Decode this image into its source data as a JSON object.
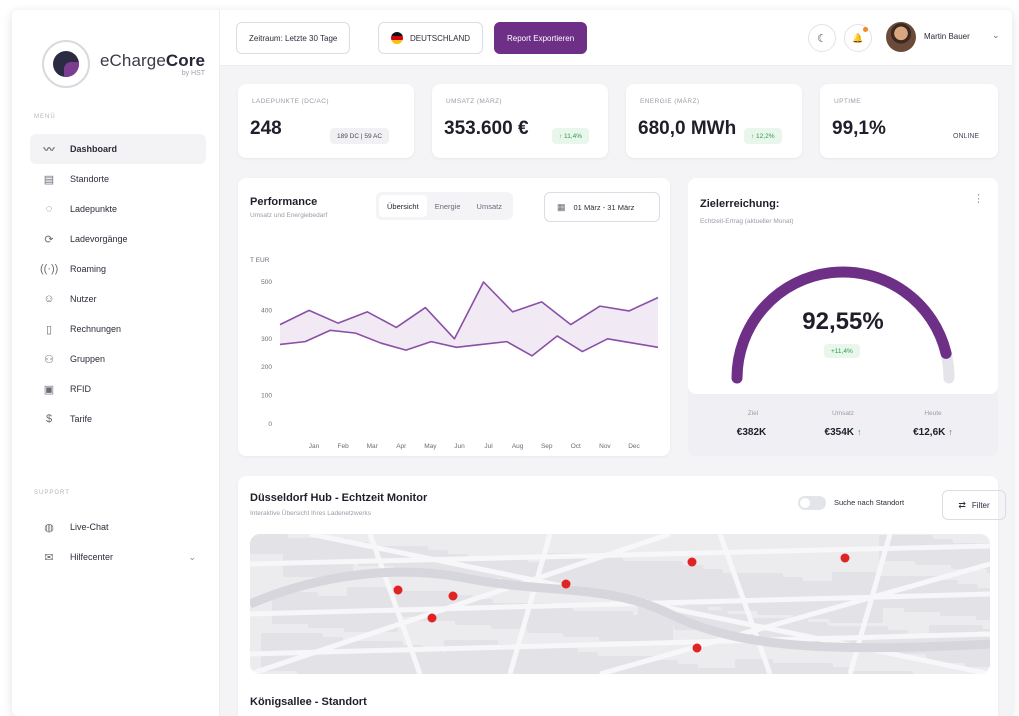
{
  "app": {
    "name_light": "eCharge",
    "name_bold": "Core",
    "sub": "by HST"
  },
  "sidebar": {
    "menu_label": "MENÜ",
    "items": [
      {
        "label": "Dashboard",
        "icon": "trend-icon",
        "glyph": "〰"
      },
      {
        "label": "Standorte",
        "icon": "building-icon",
        "glyph": "▤"
      },
      {
        "label": "Ladepunkte",
        "icon": "charger-icon",
        "glyph": "◌"
      },
      {
        "label": "Ladevorgänge",
        "icon": "refresh-icon",
        "glyph": "⟳"
      },
      {
        "label": "Roaming",
        "icon": "signal-icon",
        "glyph": "((·))"
      },
      {
        "label": "Nutzer",
        "icon": "user-icon",
        "glyph": "☺"
      },
      {
        "label": "Rechnungen",
        "icon": "invoice-icon",
        "glyph": "▯"
      },
      {
        "label": "Gruppen",
        "icon": "group-icon",
        "glyph": "⚇"
      },
      {
        "label": "RFID",
        "icon": "rfid-icon",
        "glyph": "▣"
      },
      {
        "label": "Tarife",
        "icon": "dollar-icon",
        "glyph": "$"
      }
    ],
    "support_label": "SUPPORT",
    "support_items": [
      {
        "label": "Live-Chat",
        "icon": "chat-icon",
        "glyph": "◍"
      },
      {
        "label": "Hilfecenter",
        "icon": "mail-icon",
        "glyph": "✉"
      }
    ]
  },
  "topbar": {
    "period": "Zeitraum: Letzte 30 Tage",
    "country": "DEUTSCHLAND",
    "export": "Report Exportieren",
    "theme_glyph": "☾",
    "bell_glyph": "🔔",
    "user": "Martin Bauer",
    "chev": "⌄"
  },
  "kpis": [
    {
      "label": "LADEPUNKTE (DC/AC)",
      "value": "248",
      "badge": "189 DC | 59 AC"
    },
    {
      "label": "UMSATZ (MÄRZ)",
      "value": "353.600 €",
      "badge": "↑ 11,4%"
    },
    {
      "label": "ENERGIE (MÄRZ)",
      "value": "680,0 MWh",
      "badge": "↑ 12,2%"
    },
    {
      "label": "UPTIME",
      "value": "99,1%",
      "badge": "ONLINE"
    }
  ],
  "performance": {
    "title": "Performance",
    "subtitle": "Umsatz und Energiebedarf",
    "tabs": [
      "Übersicht",
      "Energie",
      "Umsatz"
    ],
    "date_range": "01 März - 31 März",
    "calendar_glyph": "▦",
    "chart_data": {
      "type": "line",
      "ylabel": "T EUR",
      "ylim": [
        0,
        500
      ],
      "yticks": [
        0,
        100,
        200,
        300,
        400,
        500
      ],
      "categories": [
        "Jan",
        "Feb",
        "Mar",
        "Apr",
        "May",
        "Jun",
        "Jul",
        "Aug",
        "Sep",
        "Oct",
        "Nov",
        "Dec"
      ],
      "series": [
        {
          "values": [
            350,
            400,
            355,
            395,
            340,
            410,
            300,
            500,
            395,
            430,
            350,
            415,
            398,
            445
          ],
          "color": "#8a4fa6"
        },
        {
          "values": [
            280,
            290,
            330,
            320,
            285,
            260,
            290,
            270,
            280,
            290,
            240,
            310,
            255,
            300,
            285,
            270
          ],
          "color": "#8a4fa6"
        }
      ],
      "grid": false
    }
  },
  "goal": {
    "title": "Zielerreichung:",
    "subtitle": "Echtzeit-Ertrag (aktueller Monat)",
    "more_glyph": "⋮",
    "value": "92,55%",
    "percent": 92.55,
    "badge": "+11,4%",
    "stats": [
      {
        "label": "Ziel",
        "value": "€382K",
        "up": ""
      },
      {
        "label": "Umsatz",
        "value": "€354K",
        "up": "↑"
      },
      {
        "label": "Heute",
        "value": "€12,6K",
        "up": "↑"
      }
    ],
    "accent": "#6e2f86"
  },
  "map_section": {
    "title": "Düsseldorf Hub - Echtzeit Monitor",
    "subtitle": "Interaktive Übersicht Ihres Ladenetzwerks",
    "toggle_label": "Suche nach Standort",
    "filter": "Filter",
    "filter_glyph": "⇄",
    "pin_color": "#e02424"
  },
  "site_title": "Königsallee - Standort"
}
